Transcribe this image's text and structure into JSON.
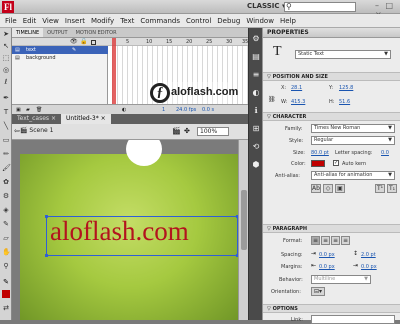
{
  "app": {
    "logo": "Fl",
    "workspace": "CLASSIC ▾",
    "search_placeholder": "",
    "window_controls": "– □ ×"
  },
  "menus": [
    "File",
    "Edit",
    "View",
    "Insert",
    "Modify",
    "Text",
    "Commands",
    "Control",
    "Debug",
    "Window",
    "Help"
  ],
  "timeline": {
    "tabs": [
      "TIMELINE",
      "OUTPUT",
      "MOTION EDITOR"
    ],
    "layers": [
      {
        "name": "text",
        "selected": true
      },
      {
        "name": "background",
        "selected": false
      }
    ],
    "frame_numbers": [
      "5",
      "10",
      "15",
      "20",
      "25",
      "30",
      "35"
    ],
    "current_frame": "1",
    "fps": "24.0 fps",
    "elapsed": "0.0 s"
  },
  "doc_tabs": [
    "Text_cases ×",
    "Untitled-3* ×"
  ],
  "edit_bar": {
    "scene": "Scene 1",
    "zoom": "100%"
  },
  "stage": {
    "text": "aloflash.com"
  },
  "watermark": {
    "text": "aloflash.com"
  },
  "properties": {
    "header": "PROPERTIES",
    "text_type": "Static Text",
    "sections": {
      "position": "POSITION AND SIZE",
      "character": "CHARACTER",
      "paragraph": "PARAGRAPH",
      "options": "OPTIONS"
    },
    "position": {
      "x_label": "X:",
      "x": "28.1",
      "y_label": "Y:",
      "y": "125.8",
      "w_label": "W:",
      "w": "415.3",
      "h_label": "H:",
      "h": "51.6"
    },
    "character": {
      "family_label": "Family:",
      "family": "Times New Roman",
      "style_label": "Style:",
      "style": "Regular",
      "size_label": "Size:",
      "size": "80.0 pt",
      "spacing_label": "Letter spacing:",
      "spacing": "0.0",
      "color_label": "Color:",
      "color_hex": "#c00000",
      "autokern_label": "Auto kern",
      "antialias_label": "Anti-alias:",
      "antialias": "Anti-alias for animation"
    },
    "paragraph": {
      "format_label": "Format:",
      "spacing_label": "Spacing:",
      "indent": "0.0 px",
      "line_spacing": "2.0 pt",
      "margins_label": "Margins:",
      "margin_left": "0.0 px",
      "margin_right": "0.0 px",
      "behavior_label": "Behavior:",
      "behavior": "Multiline",
      "orientation_label": "Orientation:"
    },
    "options": {
      "link_label": "Link:"
    }
  },
  "colors": {
    "accent": "#3b63b8",
    "stage_text": "#b3141e",
    "stage_green": "#a5c940"
  }
}
